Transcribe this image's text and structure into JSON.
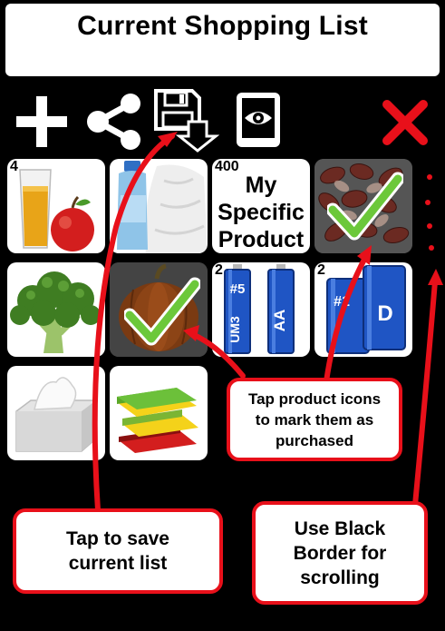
{
  "header": {
    "title": "Current Shopping List"
  },
  "grid": {
    "tiles": [
      {
        "name": "juice-apple",
        "qty": "4"
      },
      {
        "name": "detergent-towel",
        "qty": ""
      },
      {
        "name": "my-specific-product",
        "qty": "400",
        "label_lines": [
          "My",
          "Specific",
          "Product"
        ]
      },
      {
        "name": "kidney-beans",
        "qty": "",
        "checked": true
      },
      {
        "name": "broccoli",
        "qty": ""
      },
      {
        "name": "pumpkin",
        "qty": "",
        "checked": true
      },
      {
        "name": "aa-batteries",
        "qty": "2",
        "battery_labels": [
          "#5",
          "UM3",
          "AA"
        ]
      },
      {
        "name": "d-batteries",
        "qty": "2",
        "battery_labels": [
          "#1",
          "D"
        ]
      },
      {
        "name": "tissues",
        "qty": ""
      },
      {
        "name": "sponges",
        "qty": ""
      }
    ]
  },
  "callouts": {
    "mark_purchased": "Tap product icons to mark them as purchased",
    "save_list": "Tap to save current list",
    "scrolling": "Use Black Border for scrolling"
  },
  "colors": {
    "accent_red": "#e8101a",
    "check_green": "#6cc83a",
    "battery_blue": "#1f55c4"
  }
}
